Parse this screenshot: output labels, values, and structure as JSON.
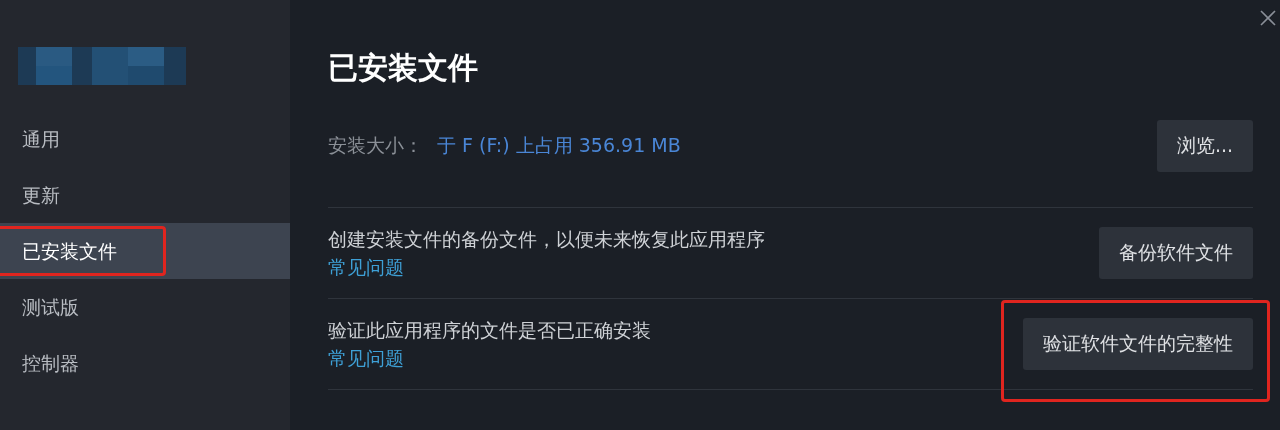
{
  "sidebar": {
    "items": [
      {
        "label": "通用",
        "selected": false,
        "highlighted": false
      },
      {
        "label": "更新",
        "selected": false,
        "highlighted": false
      },
      {
        "label": "已安装文件",
        "selected": true,
        "highlighted": true
      },
      {
        "label": "测试版",
        "selected": false,
        "highlighted": false
      },
      {
        "label": "控制器",
        "selected": false,
        "highlighted": false
      }
    ]
  },
  "main": {
    "title": "已安装文件",
    "install_size": {
      "label": "安装大小：",
      "value": "于 F (F:) 上占用 356.91 MB",
      "button": "浏览..."
    },
    "actions": [
      {
        "description": "创建安装文件的备份文件，以便未来恢复此应用程序",
        "link": "常见问题",
        "button": "备份软件文件",
        "highlighted": false
      },
      {
        "description": "验证此应用程序的文件是否已正确安装",
        "link": "常见问题",
        "button": "验证软件文件的完整性",
        "highlighted": true
      }
    ]
  }
}
